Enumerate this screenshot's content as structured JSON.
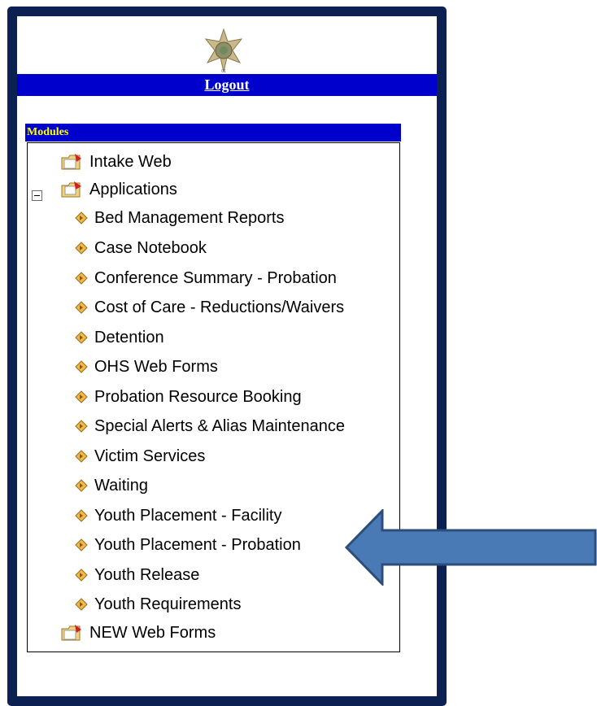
{
  "header": {
    "badge_icon": "sheriff-star-badge-icon",
    "logout_label": "Logout"
  },
  "modules": {
    "title": "Modules",
    "tree": [
      {
        "label": "Intake Web",
        "icon": "folder-icon",
        "level": 0
      },
      {
        "label": "Applications",
        "icon": "folder-open-icon",
        "level": 0,
        "expanded": true,
        "children": [
          "Bed Management Reports",
          "Case Notebook",
          "Conference Summary - Probation",
          "Cost of Care - Reductions/Waivers",
          "Detention",
          "OHS Web Forms",
          "Probation Resource Booking",
          "Special Alerts & Alias Maintenance",
          "Victim Services",
          "Waiting",
          "Youth Placement - Facility",
          "Youth Placement - Probation",
          "Youth Release",
          "Youth Requirements"
        ]
      },
      {
        "label": "NEW Web Forms",
        "icon": "folder-icon",
        "level": 0
      }
    ]
  },
  "annotation": {
    "arrow_icon": "left-arrow-icon",
    "color": "#4a7ab5",
    "points_to": "Youth Placement - Probation"
  },
  "colors": {
    "frame": "#0c2151",
    "bar": "#0000cc",
    "modules_text": "#ffff00"
  }
}
